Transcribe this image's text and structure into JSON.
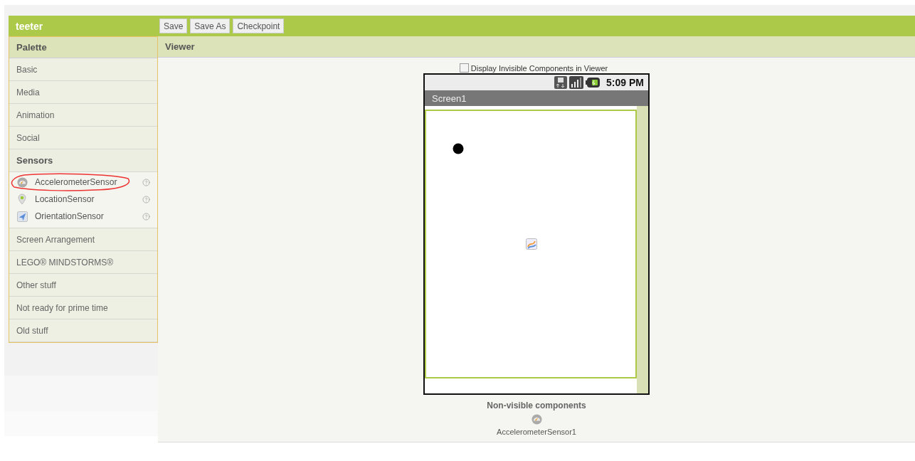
{
  "app": {
    "project": "teeter",
    "buttons": [
      "Save",
      "Save As",
      "Checkpoint"
    ]
  },
  "palette": {
    "title": "Palette",
    "categories": [
      {
        "label": "Basic",
        "expanded": false
      },
      {
        "label": "Media",
        "expanded": false
      },
      {
        "label": "Animation",
        "expanded": false
      },
      {
        "label": "Social",
        "expanded": false
      },
      {
        "label": "Sensors",
        "expanded": true,
        "components": [
          {
            "name": "AccelerometerSensor",
            "kind": "accelerometer",
            "circled": true
          },
          {
            "name": "LocationSensor",
            "kind": "location",
            "circled": false
          },
          {
            "name": "OrientationSensor",
            "kind": "orientation",
            "circled": false
          }
        ]
      },
      {
        "label": "Screen Arrangement",
        "expanded": false
      },
      {
        "label": "LEGO® MINDSTORMS®",
        "expanded": false
      },
      {
        "label": "Other stuff",
        "expanded": false
      },
      {
        "label": "Not ready for prime time",
        "expanded": false
      },
      {
        "label": "Old stuff",
        "expanded": false
      }
    ]
  },
  "viewer": {
    "title": "Viewer",
    "display_invisible": {
      "label": "Display Invisible Components in Viewer",
      "checked": false
    },
    "phone": {
      "time": "5:09 PM",
      "screen_title": "Screen1"
    },
    "non_visible": {
      "title": "Non-visible components",
      "components": [
        {
          "name": "AccelerometerSensor1",
          "kind": "accelerometer"
        }
      ]
    }
  }
}
